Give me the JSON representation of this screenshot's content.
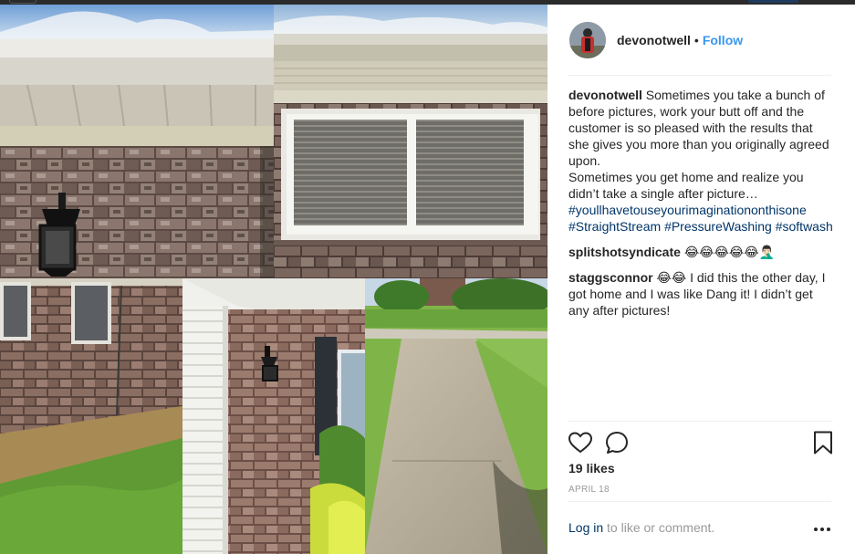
{
  "post": {
    "username": "devonotwell",
    "separator": "•",
    "follow_label": "Follow"
  },
  "comments": [
    {
      "user": "devonotwell",
      "text": "Sometimes you take a bunch of before pictures, work your butt off and the customer is so pleased with the results that she gives you more than you originally agreed upon.\nSometimes you get home and realize you didn’t take a single after picture…",
      "hashtags": [
        "#youllhavetouseyourimaginationonthisone",
        "#StraightStream",
        "#PressureWashing",
        "#softwash"
      ]
    },
    {
      "user": "splitshotsyndicate",
      "text": "😂😂😂😂😂🤦🏻‍♂️"
    },
    {
      "user": "staggsconnor",
      "text": "😂😂 I did this the other day, I got home and I was like Dang it! I didn’t get any after pictures!"
    }
  ],
  "actions": {
    "like_icon": "heart-icon",
    "comment_icon": "comment-icon",
    "save_icon": "bookmark-icon"
  },
  "likes_label": "19 likes",
  "date_label": "APRIL 18",
  "login": {
    "link_label": "Log in",
    "rest_label": "to like or comment."
  },
  "more_icon": "more-options-icon",
  "colors": {
    "link_blue": "#3897f0",
    "hashtag": "#003569",
    "muted": "#999999",
    "text": "#262626"
  }
}
